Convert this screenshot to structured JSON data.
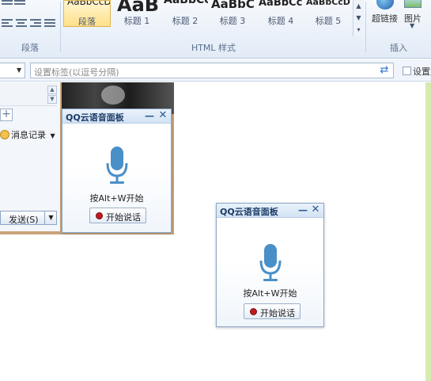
{
  "ribbon": {
    "paragraph_group_label": "段落",
    "html_styles_group_label": "HTML 样式",
    "insert_group_label": "插入",
    "styles": [
      {
        "preview": "AaBbCcD",
        "caption": "段落",
        "active": true
      },
      {
        "preview": "AaB",
        "caption": "标题 1",
        "active": false
      },
      {
        "preview": "AaBbCc",
        "caption": "标题 2",
        "active": false
      },
      {
        "preview": "AaBbC",
        "caption": "标题 3",
        "active": false
      },
      {
        "preview": "AaBbCc",
        "caption": "标题 4",
        "active": false
      },
      {
        "preview": "AaBbCcD",
        "caption": "标题 5",
        "active": false
      }
    ],
    "hyperlink_label": "超链接",
    "picture_label": "图片"
  },
  "tagbar": {
    "tag_placeholder": "设置标签(以逗号分隔)",
    "checkbox_label": "设置文"
  },
  "chat": {
    "message_record_label": "消息记录",
    "send_label": "发送(S)"
  },
  "voice_panels": [
    {
      "title": "QQ云语音面板",
      "hint": "按Alt+W开始",
      "start_label": "开始说话"
    },
    {
      "title": "QQ云语音面板",
      "hint": "按Alt+W开始",
      "start_label": "开始说话"
    }
  ],
  "colors": {
    "mic": "#4a90c8",
    "panel_border": "#8aa9c9",
    "accent_green": "#d7eab0"
  }
}
